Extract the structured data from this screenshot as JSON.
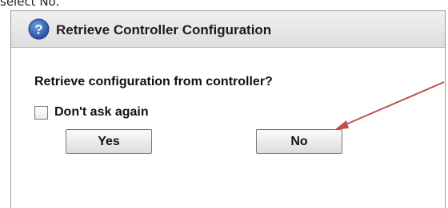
{
  "caption": {
    "fragment": "select No."
  },
  "dialog": {
    "title": "Retrieve Controller Configuration",
    "prompt": "Retrieve configuration from controller?",
    "checkbox_label": "Don't ask again",
    "checkbox_checked": false,
    "yes_label": "Yes",
    "no_label": "No",
    "icon": "help-icon"
  },
  "colors": {
    "annotation_arrow": "#c0504d",
    "icon_blue": "#2b5aa8"
  }
}
